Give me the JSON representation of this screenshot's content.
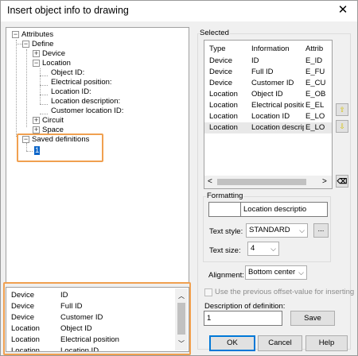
{
  "window": {
    "title": "Insert object info to drawing",
    "close_icon": "close-icon"
  },
  "tree": {
    "root": "Attributes",
    "define": "Define",
    "device": "Device",
    "location": "Location",
    "location_children": [
      "Object ID:",
      "Electrical position:",
      "Location ID:",
      "Location description:",
      "Customer location ID:"
    ],
    "circuit": "Circuit",
    "space": "Space",
    "saved": "Saved definitions",
    "saved_child": "1"
  },
  "bottom_list": {
    "rows": [
      [
        "Device",
        "ID"
      ],
      [
        "Device",
        "Full ID"
      ],
      [
        "Device",
        "Customer ID"
      ],
      [
        "Location",
        "Object ID"
      ],
      [
        "Location",
        "Electrical position"
      ],
      [
        "Location",
        "Location ID"
      ]
    ]
  },
  "selected": {
    "label": "Selected",
    "headers": [
      "Type",
      "Information",
      "Attrib"
    ],
    "rows": [
      [
        "Device",
        "ID",
        "E_ID"
      ],
      [
        "Device",
        "Full ID",
        "E_FU"
      ],
      [
        "Device",
        "Customer ID",
        "E_CU"
      ],
      [
        "Location",
        "Object ID",
        "E_OB"
      ],
      [
        "Location",
        "Electrical position",
        "E_EL"
      ],
      [
        "Location",
        "Location ID",
        "E_LO"
      ],
      [
        "Location",
        "Location descript...",
        "E_LO"
      ]
    ]
  },
  "formatting": {
    "label": "Formatting",
    "preview_text": "Location descriptio",
    "text_style_label": "Text style:",
    "text_style_value": "STANDARD",
    "more_button": "...",
    "text_size_label": "Text size:",
    "text_size_value": "4"
  },
  "alignment": {
    "label": "Alignment:",
    "value": "Bottom center"
  },
  "offset_checkbox": {
    "label": "Use the previous offset-value for inserting",
    "checked": false
  },
  "definition": {
    "label": "Description of definition:",
    "value": "1",
    "save_button": "Save"
  },
  "buttons": {
    "ok": "OK",
    "cancel": "Cancel",
    "help": "Help"
  },
  "colors": {
    "highlight": "#f0a050",
    "selection": "#0a64c8",
    "arrow_icons": "#d4c000"
  }
}
